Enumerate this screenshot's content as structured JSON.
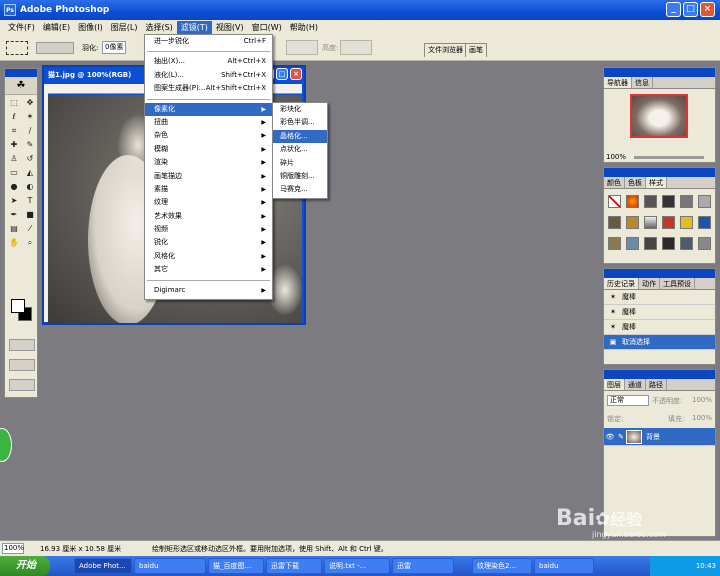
{
  "app": {
    "title": "Adobe Photoshop",
    "icon": "photoshop-icon"
  },
  "menubar": [
    "文件(F)",
    "编辑(E)",
    "图像(I)",
    "图层(L)",
    "选择(S)",
    "滤镜(T)",
    "视图(V)",
    "窗口(W)",
    "帮助(H)"
  ],
  "options": {
    "feather_label": "羽化:",
    "feather_value": "0像素",
    "height_label": "高度:",
    "tab_browser": "文件浏览器",
    "tab_brush": "画笔"
  },
  "document": {
    "title": "猫1.jpg @ 100%(RGB)"
  },
  "filter_menu": {
    "top": [
      {
        "label": "进一步锐化",
        "shortcut": "Ctrl+F"
      }
    ],
    "group2": [
      {
        "label": "抽出(X)...",
        "shortcut": "Alt+Ctrl+X"
      },
      {
        "label": "液化(L)...",
        "shortcut": "Shift+Ctrl+X"
      },
      {
        "label": "图案生成器(P)...",
        "shortcut": "Alt+Shift+Ctrl+X"
      }
    ],
    "items": [
      "像素化",
      "扭曲",
      "杂色",
      "模糊",
      "渲染",
      "画笔描边",
      "素描",
      "纹理",
      "艺术效果",
      "视频",
      "锐化",
      "风格化",
      "其它"
    ],
    "bottom": [
      "Digimarc"
    ]
  },
  "pixelate_menu": [
    "彩块化",
    "彩色半调...",
    "晶格化...",
    "点状化...",
    "碎片",
    "铜版雕刻...",
    "马赛克..."
  ],
  "navigator": {
    "tabs": [
      "导航器",
      "信息"
    ],
    "zoom": "100%"
  },
  "styles": {
    "tabs": [
      "颜色",
      "色板",
      "样式"
    ]
  },
  "history": {
    "tabs": [
      "历史记录",
      "动作",
      "工具预设"
    ],
    "items": [
      "魔棒",
      "魔棒",
      "魔棒",
      "取消选择"
    ]
  },
  "layers": {
    "tabs": [
      "图层",
      "通道",
      "路径"
    ],
    "mode": "正常",
    "opacity_label": "不透明度:",
    "opacity": "100%",
    "lock_label": "锁定:",
    "fill_label": "填充:",
    "fill": "100%",
    "layer_name": "背景"
  },
  "status": {
    "zoom": "100%",
    "size": "16.93 厘米 x 10.58 厘米",
    "hint": "绘制矩形选区或移动选区外框。要用附加选项，使用 Shift、Alt 和 Ctrl 键。"
  },
  "taskbar": {
    "start": "开始",
    "items": [
      "Adobe Phot...",
      "baidu",
      "猫_百度图...",
      "迅雷下载",
      "说明.txt -...",
      "迅雷",
      "纹理染色2...",
      "baidu"
    ],
    "clock": "10:43"
  },
  "watermark": {
    "brand": "Bai",
    "brand2": "经验",
    "url": "jingyan.baidu.com"
  },
  "colors": {
    "xp_blue": "#0b4fd6",
    "menu_highlight": "#316ac5",
    "panel_bg": "#ece9d8",
    "workspace": "#7c7b80"
  }
}
